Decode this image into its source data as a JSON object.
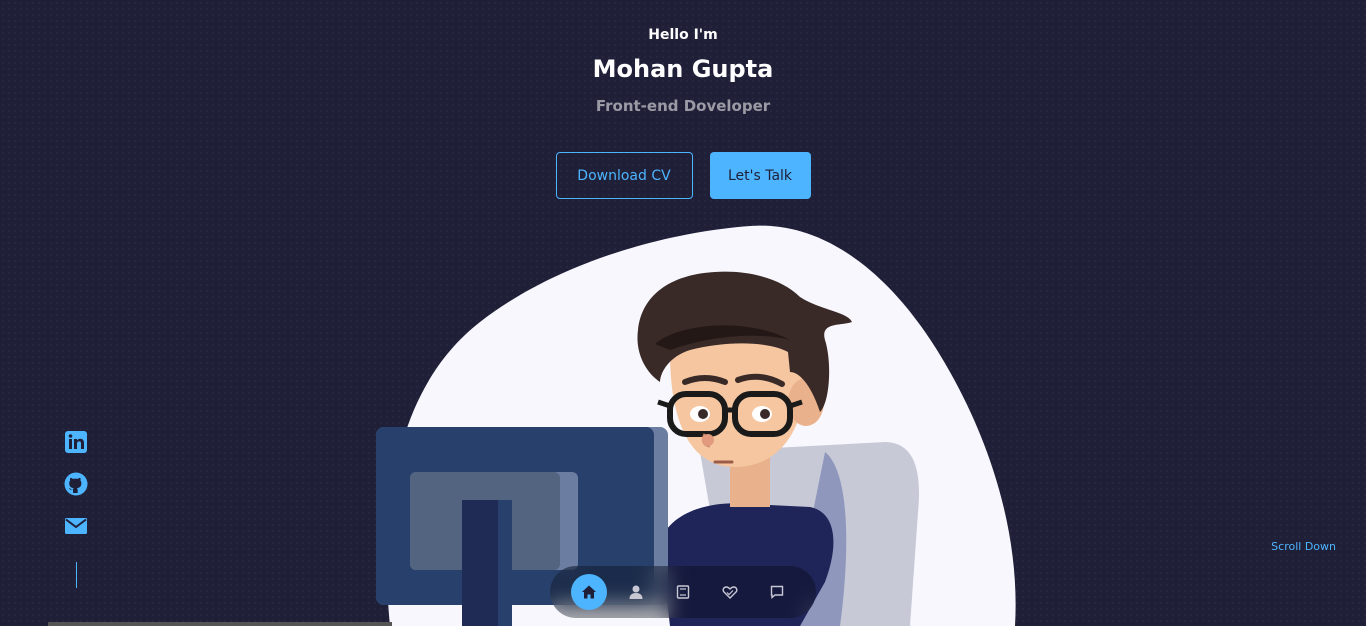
{
  "header": {
    "greeting": "Hello I'm",
    "name": "Mohan Gupta",
    "role": "Front-end Doveloper"
  },
  "buttons": {
    "download_cv": "Download CV",
    "lets_talk": "Let's Talk"
  },
  "socials": [
    {
      "icon": "linkedin-icon"
    },
    {
      "icon": "github-icon"
    },
    {
      "icon": "email-icon"
    }
  ],
  "scroll_down": "Scroll Down",
  "nav": [
    {
      "icon": "home-icon",
      "active": true
    },
    {
      "icon": "user-icon",
      "active": false
    },
    {
      "icon": "book-icon",
      "active": false
    },
    {
      "icon": "services-icon",
      "active": false
    },
    {
      "icon": "message-icon",
      "active": false
    }
  ],
  "colors": {
    "background": "#1f1f38",
    "accent": "#4db5ff"
  }
}
